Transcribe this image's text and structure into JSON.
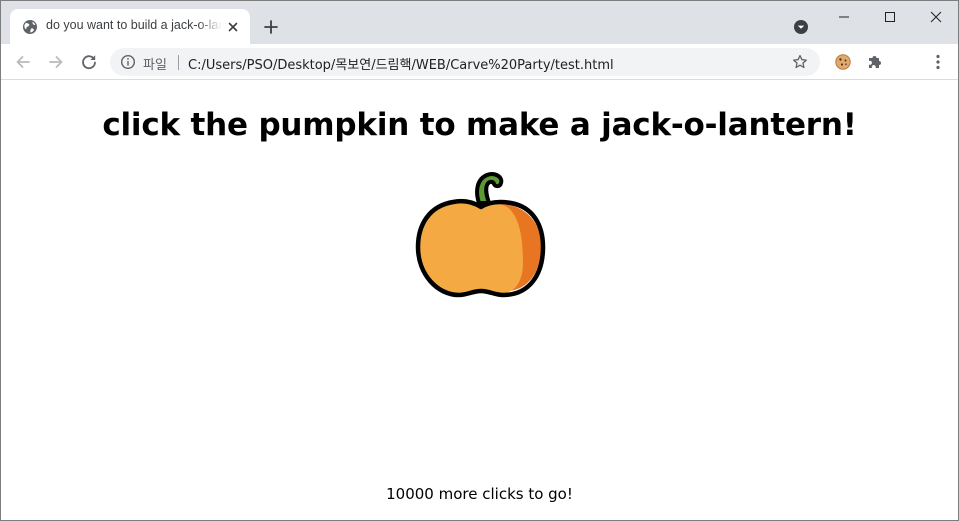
{
  "browser": {
    "tab": {
      "title": "do you want to build a jack-o-lantern?"
    },
    "address_bar": {
      "scheme_label": "파일",
      "url": "C:/Users/PSO/Desktop/목보연/드림핵/WEB/Carve%20Party/test.html"
    }
  },
  "page": {
    "heading": "click the pumpkin to make a jack-o-lantern!",
    "clicks_remaining": "10000",
    "clicks_suffix": " more clicks to go!"
  },
  "colors": {
    "pumpkin_body": "#f4a942",
    "pumpkin_shade": "#e87522",
    "stem": "#5c9a32",
    "outline": "#000000",
    "tabstrip": "#dee1e6"
  },
  "icons": {
    "favicon": "globe-icon",
    "extension_1": "cookie-icon",
    "extension_2": "puzzle-icon"
  }
}
